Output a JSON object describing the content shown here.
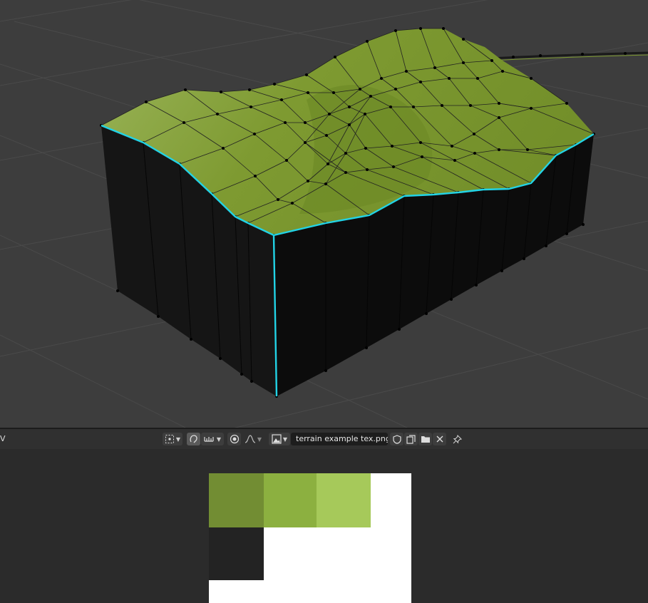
{
  "header": {
    "left_label": "V",
    "image_name": "terrain example tex.png"
  },
  "icons": {
    "pivot": "pivot-icon",
    "sticky": "sticky-selection-icon",
    "snap": "snap-icon",
    "proportional": "proportional-editing-icon",
    "falloff": "falloff-curve-icon",
    "image_browse": "image-browse-icon",
    "fake_user": "shield-icon",
    "duplicate": "duplicate-icon",
    "open": "folder-icon",
    "unlink": "close-icon",
    "pin": "pin-icon"
  },
  "texture": {
    "swatches": [
      {
        "name": "dark-green",
        "color": "#728d33"
      },
      {
        "name": "medium-green",
        "color": "#8cb040"
      },
      {
        "name": "light-green",
        "color": "#a6c95a"
      },
      {
        "name": "black",
        "color": "#232323"
      }
    ]
  },
  "colors": {
    "viewport_bg": "#3d3d3d",
    "terrain_top": "#7c9830",
    "seam": "#22d3e6",
    "side": "#121212"
  }
}
